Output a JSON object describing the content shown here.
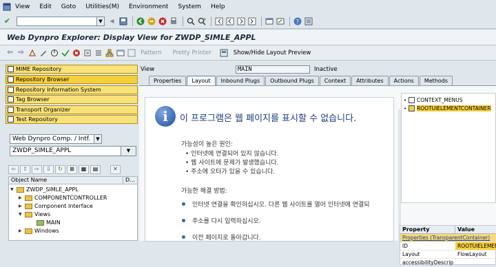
{
  "menubar": {
    "items": [
      "View",
      "Edit",
      "Goto",
      "Utilities(M)",
      "Environment",
      "System",
      "Help"
    ]
  },
  "title": "Web Dynpro Explorer: Display View for ZWDP_SIMLE_APPL",
  "app_toolbar": {
    "pattern": "Pattern",
    "pretty_printer": "Pretty Printer",
    "show_hide": "Show/Hide Layout Preview"
  },
  "nav": {
    "items": [
      "MIME Repository",
      "Repository Browser",
      "Repository Information System",
      "Tag Browser",
      "Transport Organizer",
      "Test Repository"
    ]
  },
  "object_type": "Web Dynpro Comp. / Intf.",
  "object_name": "ZWDP_SIMLE_APPL",
  "tree": {
    "col_object": "Object Name",
    "col_d": "D...",
    "rows": [
      "ZWDP_SIMLE_APPL",
      "COMPONENTCONTROLLER",
      "Component Interface",
      "Views",
      "MAIN",
      "Windows"
    ]
  },
  "view": {
    "label": "View",
    "value": "MAIN",
    "status": "Inactive"
  },
  "tabs": [
    "Properties",
    "Layout",
    "Inbound Plugs",
    "Outbound Plugs",
    "Context",
    "Attributes",
    "Actions",
    "Methods"
  ],
  "browser_error": {
    "title": "이 프로그램은 웹 페이지를 표시할 수 없습니다.",
    "causes_heading": "가능성이 높은 원인:",
    "causes": [
      "인터넷에 연결되어 있지 않습니다.",
      "웹 사이트에 문제가 발생했습니다.",
      "주소에 오타가 있을 수 있습니다."
    ],
    "solutions_heading": "가능한 해결 방법:",
    "solutions": [
      "인터넷 연결을 확인하십시오. 다른 웹 사이트를 열어 인터넷에 연결되",
      "주소를 다시 입력하십시오.",
      "이전 페이지로 돌아갑니다."
    ]
  },
  "context_tree": {
    "items": [
      "CONTEXT_MENUS",
      "ROOTUIELEMENTCONTAINER"
    ]
  },
  "property_grid": {
    "col_property": "Property",
    "col_value": "Value",
    "section": "Properties (TransparentContainer)",
    "rows": [
      {
        "property": "ID",
        "value": "ROOTUIELEMEN"
      },
      {
        "property": "Layout",
        "value": "FlowLayout"
      },
      {
        "property": "accessibilityDescrip",
        "value": ""
      }
    ]
  }
}
